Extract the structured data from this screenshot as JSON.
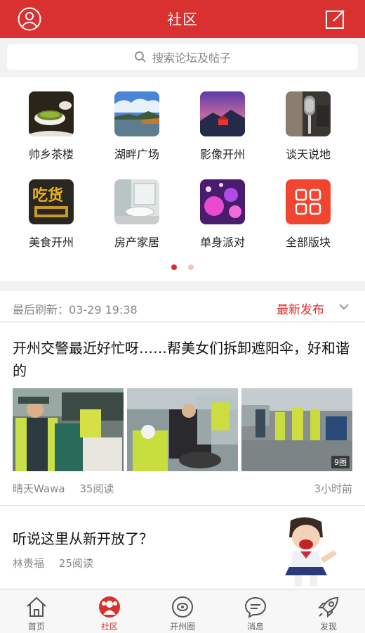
{
  "header": {
    "title": "社区",
    "left_icon": "user-profile-icon",
    "right_icon": "compose-icon",
    "color": "#d9312f"
  },
  "search": {
    "placeholder": "搜索论坛及帖子",
    "icon": "search-icon"
  },
  "forums": [
    {
      "label": "帅乡茶楼",
      "icon": "tea-cup-image"
    },
    {
      "label": "湖畔广场",
      "icon": "lake-landscape-image"
    },
    {
      "label": "影像开州",
      "icon": "night-pavilion-image"
    },
    {
      "label": "谈天说地",
      "icon": "microphone-image"
    },
    {
      "label": "美食开州",
      "icon": "food-calligraphy-image",
      "text_on_image": "吃货"
    },
    {
      "label": "房产家居",
      "icon": "bathroom-interior-image"
    },
    {
      "label": "单身派对",
      "icon": "party-balloons-image"
    },
    {
      "label": "全部版块",
      "icon": "grid-apps-icon"
    }
  ],
  "pager": {
    "count": 2,
    "active": 0
  },
  "refresh": {
    "text": "最后刷新：03-29  19:38",
    "sort_label": "最新发布",
    "sort_icon": "chevron-down-icon"
  },
  "posts": [
    {
      "title": "开州交警最近好忙呀……帮美女们拆卸遮阳伞，好和谐的",
      "author": "晴天Wawa",
      "reads": "35阅读",
      "time": "3小时前",
      "image_count": "9图"
    },
    {
      "title": "听说这里从新开放了？",
      "author": "林贵福",
      "reads": "25阅读"
    }
  ],
  "tabs": [
    {
      "label": "首页",
      "icon": "home-icon",
      "active": false
    },
    {
      "label": "社区",
      "icon": "community-icon",
      "active": true
    },
    {
      "label": "开州圈",
      "icon": "circle-icon",
      "active": false
    },
    {
      "label": "消息",
      "icon": "message-icon",
      "active": false
    },
    {
      "label": "发现",
      "icon": "rocket-icon",
      "active": false
    }
  ]
}
